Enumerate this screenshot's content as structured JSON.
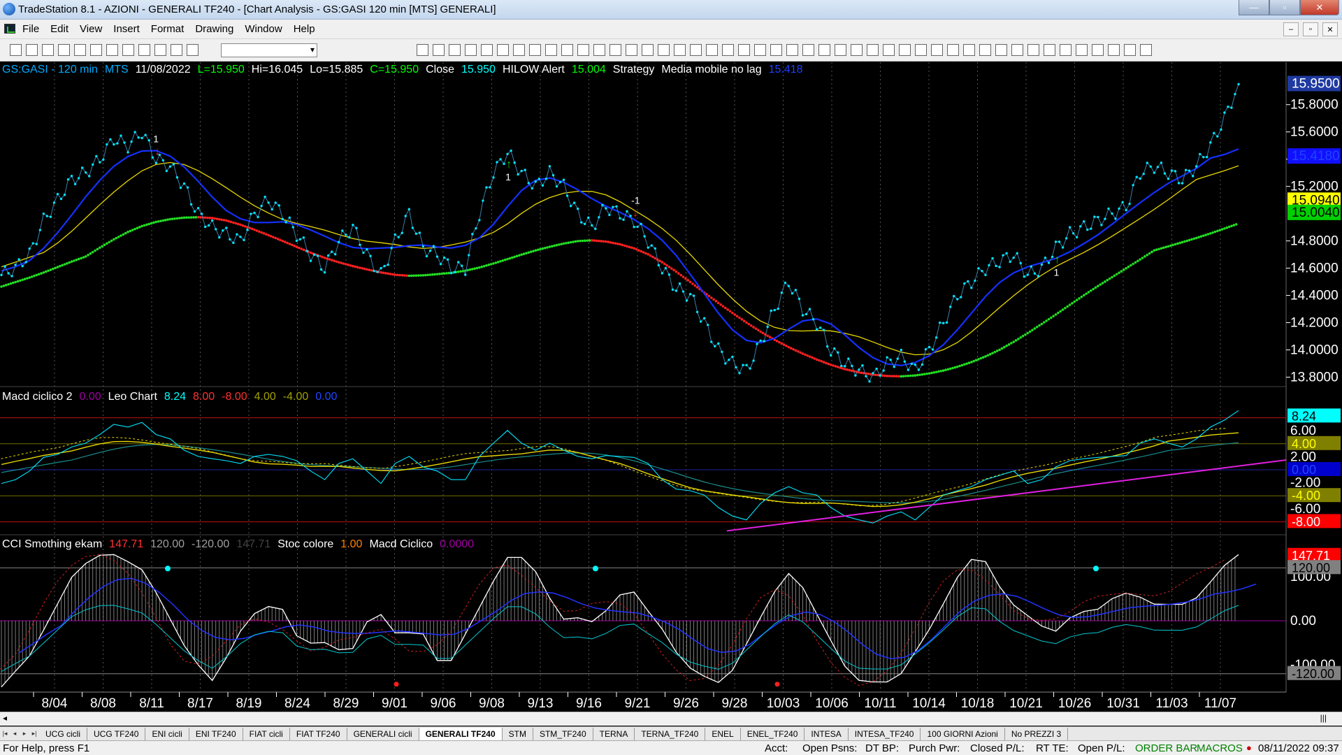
{
  "window": {
    "title": "TradeStation 8.1 - AZIONI - GENERALI TF240 - [Chart Analysis - GS:GASI  120 min  [MTS] GENERALI]",
    "minimize": "—",
    "maximize": "▫",
    "close": "✕"
  },
  "menu": [
    "File",
    "Edit",
    "View",
    "Insert",
    "Format",
    "Drawing",
    "Window",
    "Help"
  ],
  "toolbar": {
    "symbol_combo": ""
  },
  "price_header": {
    "symbol": "GS:GASI - 120 min",
    "tag": "MTS",
    "date": "11/08/2022",
    "last": "L=15.950",
    "high": "Hi=16.045",
    "low": "Lo=15.885",
    "close": "C=15.950",
    "close_label": "Close",
    "close_value": "15.950",
    "alert_label": "HILOW Alert",
    "alert_value": "15.004",
    "strategy_label": "Strategy",
    "ma_label": "Media mobile no lag",
    "ma_value": "15.418"
  },
  "macd_header": {
    "name": "Macd ciclico 2",
    "v0": "0.00",
    "leo_label": "Leo Chart",
    "v1": "8.24",
    "v2": "8.00",
    "v3": "-8.00",
    "v4": "4.00",
    "v5": "-4.00",
    "v6": "0.00"
  },
  "cci_header": {
    "name": "CCI Smothing ekam",
    "v1": "147.71",
    "v2": "120.00",
    "v3": "-120.00",
    "v4": "147.71",
    "stoc_label": "Stoc colore",
    "stoc_value": "1.00",
    "macd_label": "Macd Ciclico",
    "macd_value": "0.0000"
  },
  "price_axis": [
    "15.8000",
    "15.6000",
    "15.4000",
    "15.2000",
    "14.8000",
    "14.6000",
    "14.4000",
    "14.2000",
    "14.0000",
    "13.8000"
  ],
  "price_tags": [
    {
      "text": "15.9500",
      "bg": "#1f3aa0",
      "fg": "#ffffff"
    },
    {
      "text": "15.4180",
      "bg": "#1010ff",
      "fg": "#2244ff"
    },
    {
      "text": "15.0940",
      "bg": "#ffff00",
      "fg": "#000000"
    },
    {
      "text": "15.0040",
      "bg": "#00d000",
      "fg": "#000000"
    }
  ],
  "macd_axis": [
    "6.00",
    "2.00",
    "-2.00",
    "-6.00"
  ],
  "macd_tags": [
    {
      "text": "8.24",
      "bg": "#00ffff",
      "fg": "#000000"
    },
    {
      "text": "4.00",
      "bg": "#808000",
      "fg": "#ffff00"
    },
    {
      "text": "0.00",
      "bg": "#0000cc",
      "fg": "#2244ff"
    },
    {
      "text": "-4.00",
      "bg": "#808000",
      "fg": "#ffff00"
    },
    {
      "text": "-8.00",
      "bg": "#ff0000",
      "fg": "#ffffff"
    }
  ],
  "cci_axis": [
    "100.00",
    "0.00",
    "-100.00"
  ],
  "cci_tags": [
    {
      "text": "147.71",
      "bg": "#ff0000",
      "fg": "#ffffff"
    },
    {
      "text": "120.00",
      "bg": "#808080",
      "fg": "#000000"
    },
    {
      "text": "-120.00",
      "bg": "#808080",
      "fg": "#000000"
    }
  ],
  "signals": [
    {
      "label": "1",
      "type": "sell"
    },
    {
      "label": "1",
      "type": "buy"
    },
    {
      "label": "-1",
      "type": "sell"
    },
    {
      "label": "1",
      "type": "buy"
    }
  ],
  "dates": [
    "8/04",
    "8/08",
    "8/11",
    "8/17",
    "8/19",
    "8/24",
    "8/29",
    "9/01",
    "9/06",
    "9/08",
    "9/13",
    "9/16",
    "9/21",
    "9/26",
    "9/28",
    "10/03",
    "10/06",
    "10/11",
    "10/14",
    "10/18",
    "10/21",
    "10/26",
    "10/31",
    "11/03",
    "11/07"
  ],
  "tabs": [
    "UCG cicli",
    "UCG TF240",
    "ENI cicli",
    "ENI TF240",
    "FIAT cicli",
    "FIAT TF240",
    "GENERALI cicli",
    "GENERALI TF240",
    "STM",
    "STM_TF240",
    "TERNA",
    "TERNA_TF240",
    "ENEL",
    "ENEL_TF240",
    "INTESA",
    "INTESA_TF240",
    "100 GIORNI Azioni",
    "No PREZZI 3"
  ],
  "active_tab": "GENERALI TF240",
  "status": {
    "help": "For Help, press F1",
    "acct": "Acct:",
    "open_psns": "Open Psns:",
    "dt_bp": "DT BP:",
    "purch_pwr": "Purch Pwr:",
    "closed_pl": "Closed P/L:",
    "rt_te": "RT TE:",
    "open_pl": "Open P/L:",
    "order_bar": "ORDER BAR",
    "macros": "MACROS",
    "datetime": "08/11/2022 09:37"
  },
  "chart_data": {
    "type": "line",
    "price_series": {
      "y_range": [
        13.7,
        16.05
      ],
      "close": [
        14.55,
        14.6,
        14.7,
        14.95,
        15.1,
        15.25,
        15.3,
        15.4,
        15.55,
        15.5,
        15.6,
        15.4,
        15.35,
        15.2,
        15.0,
        14.9,
        14.85,
        14.8,
        15.0,
        15.1,
        15.0,
        14.85,
        14.7,
        14.6,
        14.8,
        14.9,
        14.7,
        14.55,
        14.8,
        15.0,
        14.75,
        14.7,
        14.6,
        14.6,
        15.0,
        15.3,
        15.45,
        15.3,
        15.2,
        15.3,
        15.2,
        15.0,
        14.9,
        15.05,
        15.0,
        14.95,
        14.8,
        14.6,
        14.45,
        14.4,
        14.2,
        14.0,
        13.9,
        13.85,
        14.05,
        14.3,
        14.5,
        14.3,
        14.2,
        14.0,
        13.9,
        13.85,
        13.8,
        13.9,
        13.95,
        13.85,
        14.0,
        14.2,
        14.4,
        14.5,
        14.6,
        14.65,
        14.7,
        14.55,
        14.6,
        14.75,
        14.85,
        14.9,
        14.95,
        15.0,
        15.05,
        15.3,
        15.35,
        15.3,
        15.25,
        15.35,
        15.5,
        15.7,
        15.95
      ]
    }
  }
}
